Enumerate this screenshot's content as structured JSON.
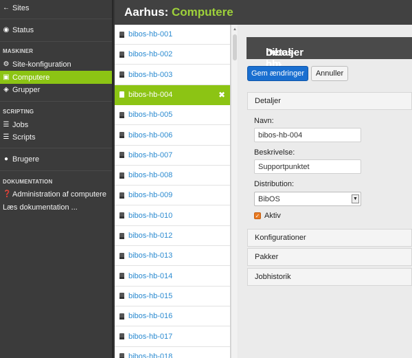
{
  "sidebar": {
    "top_items": [
      {
        "label": "Sites",
        "icon": "arrow-left-icon"
      },
      {
        "label": "Status",
        "icon": "eye-icon"
      }
    ],
    "section_maskiner": "MASKINER",
    "maskiner_items": [
      {
        "label": "Site-konfiguration",
        "icon": "gear-icon"
      },
      {
        "label": "Computere",
        "icon": "monitor-icon"
      },
      {
        "label": "Grupper",
        "icon": "tag-icon"
      }
    ],
    "section_scripting": "SCRIPTING",
    "scripting_items": [
      {
        "label": "Jobs",
        "icon": "list-icon"
      },
      {
        "label": "Scripts",
        "icon": "list-icon"
      }
    ],
    "brugere": {
      "label": "Brugere",
      "icon": "user-icon"
    },
    "section_doc": "DOKUMENTATION",
    "doc_items": [
      {
        "label": "Administration af computere",
        "icon": "question-icon"
      },
      {
        "label": "Læs dokumentation ..."
      }
    ]
  },
  "header": {
    "site": "Aarhus:",
    "page": "Computere"
  },
  "computers": [
    "bibos-hb-001",
    "bibos-hb-002",
    "bibos-hb-003",
    "bibos-hb-004",
    "bibos-hb-005",
    "bibos-hb-006",
    "bibos-hb-007",
    "bibos-hb-008",
    "bibos-hb-009",
    "bibos-hb-010",
    "bibos-hb-012",
    "bibos-hb-013",
    "bibos-hb-014",
    "bibos-hb-015",
    "bibos-hb-016",
    "bibos-hb-017",
    "bibos-hb-018"
  ],
  "selected_computer": "bibos-hb-004",
  "details": {
    "title_prefix": "Detaljer om",
    "title_name": "bibos-hb-004",
    "save_label": "Gem ændringer",
    "cancel_label": "Annuller",
    "section_details": "Detaljer",
    "name_label": "Navn:",
    "name_value": "bibos-hb-004",
    "desc_label": "Beskrivelse:",
    "desc_value": "Supportpunktet",
    "dist_label": "Distribution:",
    "dist_value": "BibOS",
    "active_label": "Aktiv",
    "active_checked": true,
    "section_config": "Konfigurationer",
    "section_packages": "Pakker",
    "section_jobs": "Jobhistorik"
  },
  "colors": {
    "accent": "#8cc414",
    "primary_button": "#1a6fd0",
    "checkbox": "#e87a22"
  }
}
